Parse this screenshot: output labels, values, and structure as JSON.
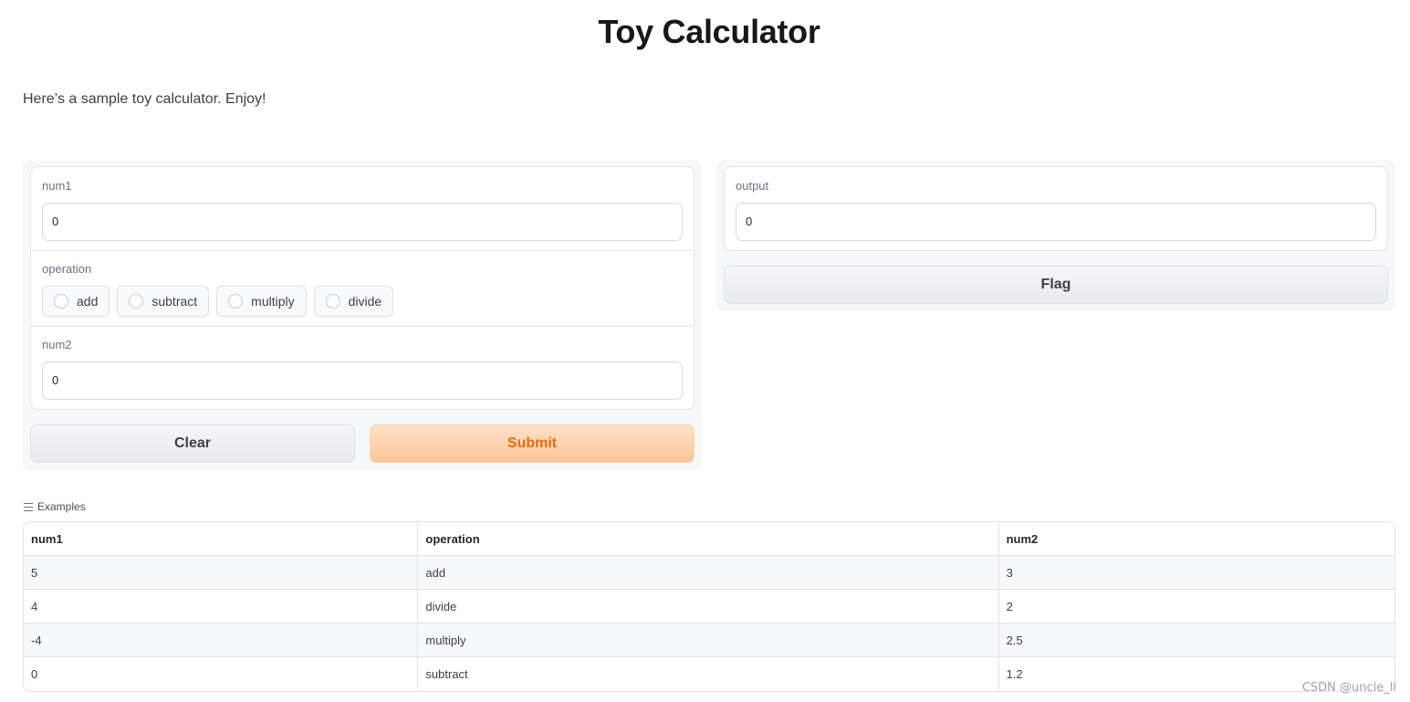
{
  "header": {
    "title": "Toy Calculator",
    "description": "Here’s a sample toy calculator. Enjoy!"
  },
  "inputs": {
    "num1": {
      "label": "num1",
      "value": "0"
    },
    "operation": {
      "label": "operation",
      "options": [
        "add",
        "subtract",
        "multiply",
        "divide"
      ]
    },
    "num2": {
      "label": "num2",
      "value": "0"
    }
  },
  "buttons": {
    "clear": "Clear",
    "submit": "Submit",
    "flag": "Flag"
  },
  "output": {
    "label": "output",
    "value": "0"
  },
  "examples": {
    "label": "Examples",
    "icon": "list-icon",
    "headers": [
      "num1",
      "operation",
      "num2"
    ],
    "rows": [
      [
        "5",
        "add",
        "3"
      ],
      [
        "4",
        "divide",
        "2"
      ],
      [
        "-4",
        "multiply",
        "2.5"
      ],
      [
        "0",
        "subtract",
        "1.2"
      ]
    ]
  },
  "watermark": "CSDN @uncle_ll",
  "colors": {
    "accent": "#ea6a0c",
    "primary_button": "#fdc597",
    "panel_bg": "#f7f8fa"
  }
}
